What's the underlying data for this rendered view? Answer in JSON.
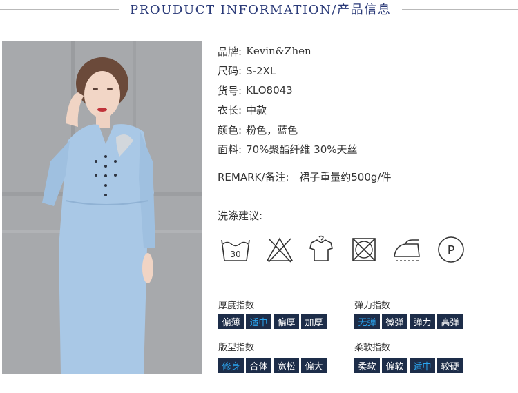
{
  "header": {
    "title": "PROUDUCT INFORMATION/产品信息"
  },
  "photo": {
    "alt_subject": "model-wearing-light-blue-dress"
  },
  "info": [
    {
      "label": "品牌:",
      "value": "Kevin&Zhen"
    },
    {
      "label": "尺码:",
      "value": "S-2XL"
    },
    {
      "label": "货号:",
      "value": "KLO8043"
    },
    {
      "label": "衣长:",
      "value": "中款"
    },
    {
      "label": "颜色:",
      "value": "粉色，蓝色"
    },
    {
      "label": "面料:",
      "value": "70%聚酯纤维 30%天丝"
    }
  ],
  "remark": {
    "label": "REMARK/备注:",
    "value": "裙子重量约500g/件"
  },
  "wash": {
    "title": "洗涤建议:",
    "icons": [
      {
        "name": "wash-30-icon",
        "text": "30"
      },
      {
        "name": "no-bleach-icon"
      },
      {
        "name": "hang-dry-icon"
      },
      {
        "name": "no-tumble-dry-icon"
      },
      {
        "name": "low-iron-icon"
      },
      {
        "name": "dry-clean-p-icon",
        "text": "P"
      }
    ]
  },
  "indices": {
    "thickness": {
      "title": "厚度指数",
      "options": [
        "偏薄",
        "适中",
        "偏厚",
        "加厚"
      ],
      "active": "适中"
    },
    "elasticity": {
      "title": "弹力指数",
      "options": [
        "无弹",
        "微弹",
        "弹力",
        "高弹"
      ],
      "active": "无弹"
    },
    "fit": {
      "title": "版型指数",
      "options": [
        "修身",
        "合体",
        "宽松",
        "偏大"
      ],
      "active": "修身"
    },
    "softness": {
      "title": "柔软指数",
      "options": [
        "柔软",
        "偏软",
        "适中",
        "较硬"
      ],
      "active": "适中"
    }
  },
  "colors": {
    "header_text": "#2a3a78",
    "pill_bg": "#1d2d49",
    "pill_active_text": "#2aa4ef",
    "dress": "#a9c8e6"
  }
}
